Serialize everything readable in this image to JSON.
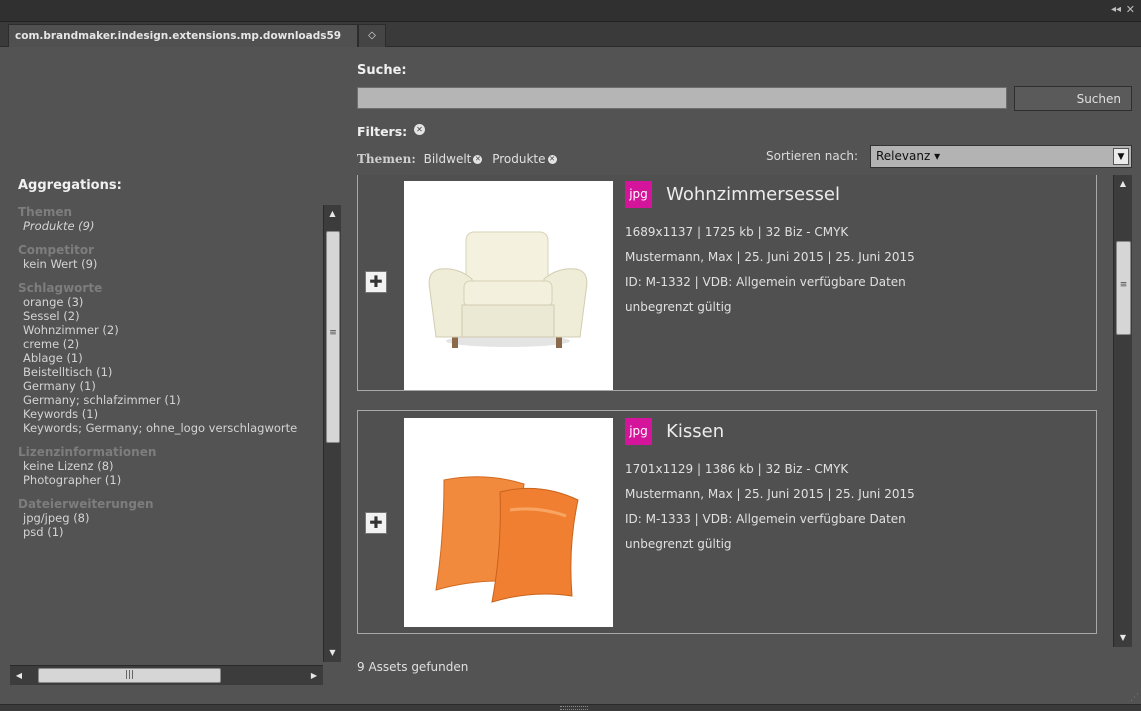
{
  "window": {
    "collapse_glyph": "◂◂",
    "close_glyph": "✕"
  },
  "tab": {
    "title": "com.brandmaker.indesign.extensions.mp.downloads59",
    "menu_glyph": "◇"
  },
  "search": {
    "label": "Suche:",
    "value": "",
    "button_label": "Suchen"
  },
  "filters": {
    "label": "Filters:",
    "clear_glyph": "✕",
    "themen_label": "Themen:",
    "chips": [
      {
        "label": "Bildwelt"
      },
      {
        "label": "Produkte"
      }
    ]
  },
  "sort": {
    "label": "Sortieren nach:",
    "value": "Relevanz ▾",
    "arrow": "▼"
  },
  "aggregations": {
    "title": "Aggregations:",
    "groups": [
      {
        "title": "Themen",
        "items": [
          "Produkte (9)"
        ]
      },
      {
        "title": "Competitor",
        "items": [
          "kein Wert (9)"
        ]
      },
      {
        "title": "Schlagworte",
        "items": [
          "orange (3)",
          "Sessel (2)",
          "Wohnzimmer (2)",
          "creme (2)",
          "Ablage (1)",
          "Beistelltisch (1)",
          "Germany (1)",
          "Germany; schlafzimmer (1)",
          "Keywords (1)",
          "Keywords; Germany; ohne_logo verschlagworte"
        ]
      },
      {
        "title": "Lizenzinformationen",
        "items": [
          "keine Lizenz (8)",
          "Photographer (1)"
        ]
      },
      {
        "title": "Dateierweiterungen",
        "items": [
          "jpg/jpeg (8)",
          "psd (1)"
        ]
      }
    ]
  },
  "results": {
    "items": [
      {
        "type": "jpg",
        "title": "Wohnzimmersessel",
        "dimensions": "1689x1137 | 1725 kb | 32 Biz - CMYK",
        "author_dates": "Mustermann, Max | 25. Juni 2015 | 25. Juni 2015",
        "id_vdb": "ID: M-1332 | VDB: Allgemein verfügbare Daten",
        "validity": "unbegrenzt gültig"
      },
      {
        "type": "jpg",
        "title": "Kissen",
        "dimensions": "1701x1129 | 1386 kb | 32 Biz - CMYK",
        "author_dates": "Mustermann, Max | 25. Juni 2015 | 25. Juni 2015",
        "id_vdb": "ID: M-1333 | VDB: Allgemein verfügbare Daten",
        "validity": "unbegrenzt gültig"
      }
    ],
    "count_label": "9 Assets gefunden"
  },
  "colors": {
    "panel_bg": "#535353",
    "badge_jpg": "#d4149a",
    "chair": "#efecd8",
    "pillow": "#f07f31"
  },
  "icons": {
    "add": "plus-icon",
    "scroll_up": "arrow-up-icon",
    "scroll_down": "arrow-down-icon",
    "scroll_left": "arrow-left-icon",
    "scroll_right": "arrow-right-icon"
  }
}
